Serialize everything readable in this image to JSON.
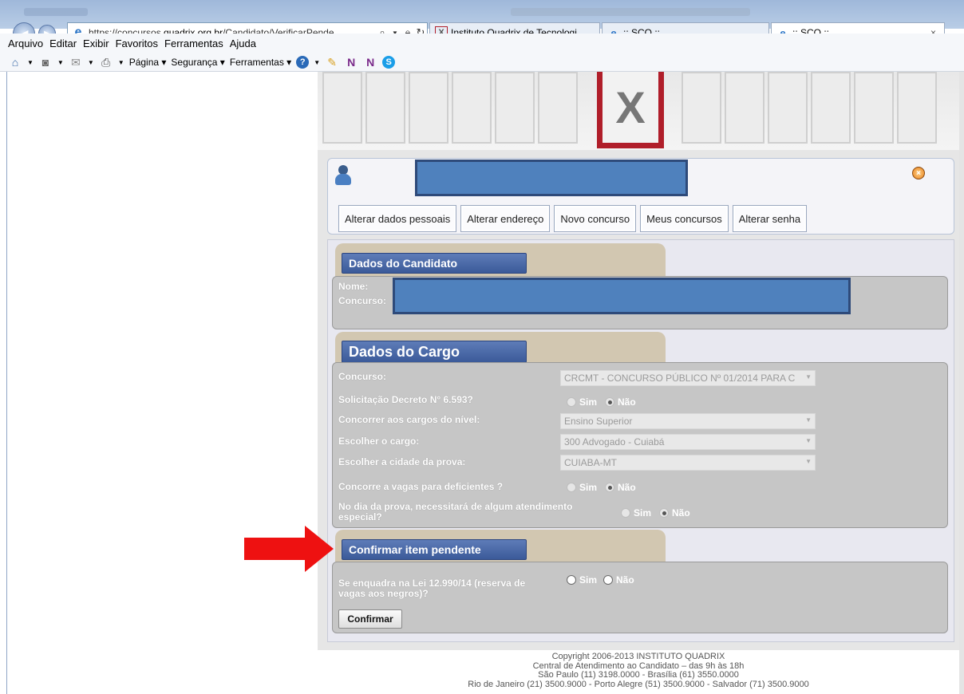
{
  "browser": {
    "url_prefix": "https://concursos.",
    "url_domain": "quadrix.org.br",
    "url_path": "/Candidato/VerificarPende",
    "tabs": [
      {
        "label": "Instituto Quadrix de Tecnologi...",
        "icon": "quadrix-favicon"
      },
      {
        "label": ":: SCQ ::",
        "icon": "ie-icon"
      },
      {
        "label": ":: SCQ ::",
        "icon": "ie-icon"
      }
    ],
    "menu": [
      "Arquivo",
      "Editar",
      "Exibir",
      "Favoritos",
      "Ferramentas",
      "Ajuda"
    ],
    "commands": [
      "Página ▾",
      "Segurança ▾",
      "Ferramentas ▾"
    ],
    "logo_letter": "X"
  },
  "user_tabs": [
    "Alterar dados pessoais",
    "Alterar endereço",
    "Novo concurso",
    "Meus concursos",
    "Alterar senha"
  ],
  "candidato": {
    "title": "Dados do Candidato",
    "nome_label": "Nome:",
    "concurso_label": "Concurso:"
  },
  "cargo": {
    "title": "Dados do Cargo",
    "concurso_label": "Concurso:",
    "concurso_value": "CRCMT - CONCURSO PÚBLICO Nº 01/2014 PARA C",
    "decreto_label": "Solicitação Decreto N° 6.593?",
    "nivel_label": "Concorrer aos cargos do nível:",
    "nivel_value": "Ensino Superior",
    "cargo_label": "Escolher o cargo:",
    "cargo_value": "300 Advogado - Cuiabá",
    "cidade_label": "Escolher a cidade da prova:",
    "cidade_value": "CUIABA-MT",
    "deficientes_label": "Concorre a vagas para deficientes ?",
    "atendimento_label_1": "No dia da prova, necessitará de algum atendimento",
    "atendimento_label_2": "especial?",
    "sim": "Sim",
    "nao": "Não"
  },
  "pendente": {
    "title": "Confirmar item pendente",
    "question_1": "Se enquadra na Lei 12.990/14 (reserva de",
    "question_2": "vagas aos negros)?",
    "sim": "Sim",
    "nao": "Não",
    "button": "Confirmar"
  },
  "footer": [
    "Copyright 2006-2013 INSTITUTO QUADRIX",
    "Central de Atendimento ao Candidato – das 9h às 18h",
    "São Paulo (11) 3198.0000 - Brasília (61) 3550.0000",
    "Rio de Janeiro (21) 3500.9000 - Porto Alegre (51) 3500.9000 - Salvador (71) 3500.9000"
  ],
  "colors": {
    "accent": "#3b5a99",
    "arrow": "#ee1111",
    "tab_bg": "#d2c7b1"
  }
}
